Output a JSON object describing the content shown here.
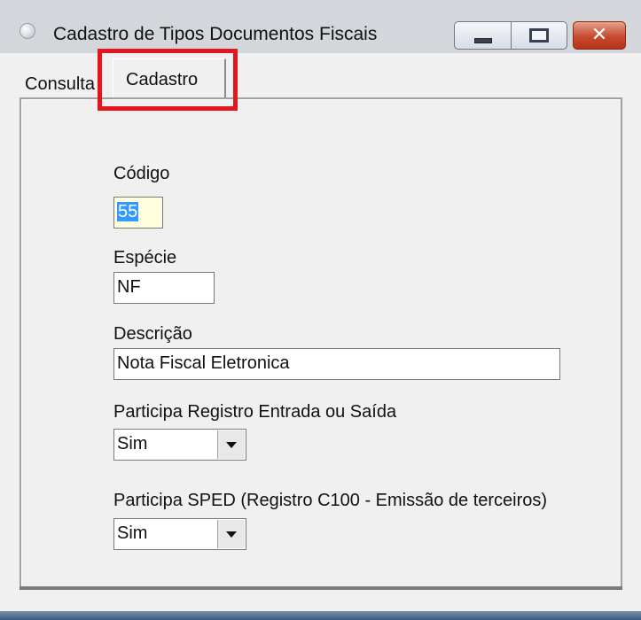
{
  "window": {
    "title": "Cadastro de Tipos Documentos Fiscais",
    "controls": {
      "minimize": "minimize",
      "maximize": "maximize",
      "close": "✕"
    }
  },
  "tabs": [
    {
      "label": "Consulta"
    },
    {
      "label": "Cadastro",
      "active": true
    }
  ],
  "highlight_color": "#e3151e",
  "form": {
    "codigo": {
      "label": "Código",
      "value": "55"
    },
    "especie": {
      "label": "Espécie",
      "value": "NF"
    },
    "descricao": {
      "label": "Descrição",
      "value": "Nota Fiscal Eletronica"
    },
    "participa_registro": {
      "label": "Participa Registro Entrada ou Saída",
      "value": "Sim"
    },
    "participa_sped": {
      "label": "Participa SPED (Registro C100 - Emissão de terceiros)",
      "value": "Sim"
    }
  }
}
